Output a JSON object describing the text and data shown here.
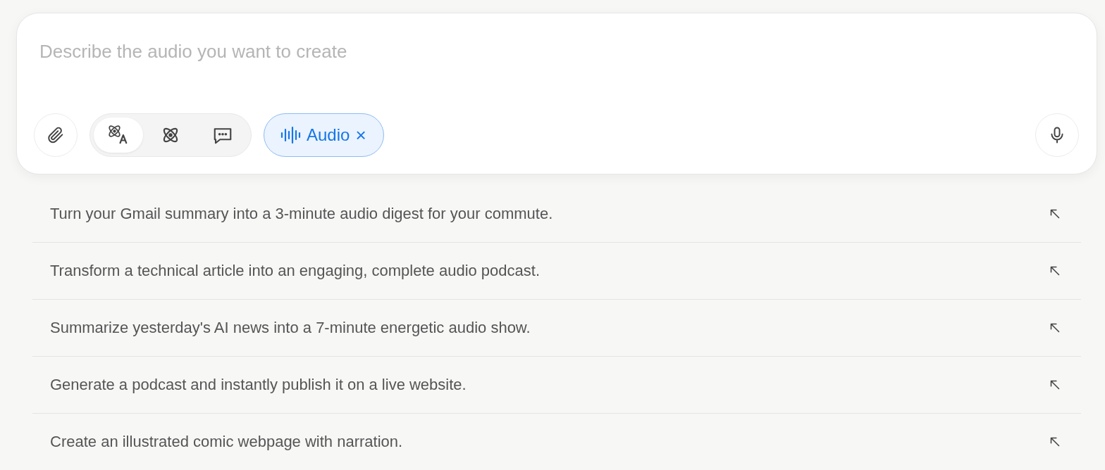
{
  "composer": {
    "placeholder": "Describe the audio you want to create",
    "modes": [
      {
        "kind": "atom-text",
        "selected": true
      },
      {
        "kind": "atom",
        "selected": false
      },
      {
        "kind": "chat",
        "selected": false
      }
    ],
    "chip": {
      "label": "Audio",
      "close": "×"
    }
  },
  "suggestions": [
    "Turn your Gmail summary into a 3-minute audio digest for your commute.",
    "Transform a technical article into an engaging, complete audio podcast.",
    "Summarize yesterday's AI news into a 7-minute energetic audio show.",
    "Generate a podcast and instantly publish it on a live website.",
    "Create an illustrated comic webpage with narration."
  ]
}
